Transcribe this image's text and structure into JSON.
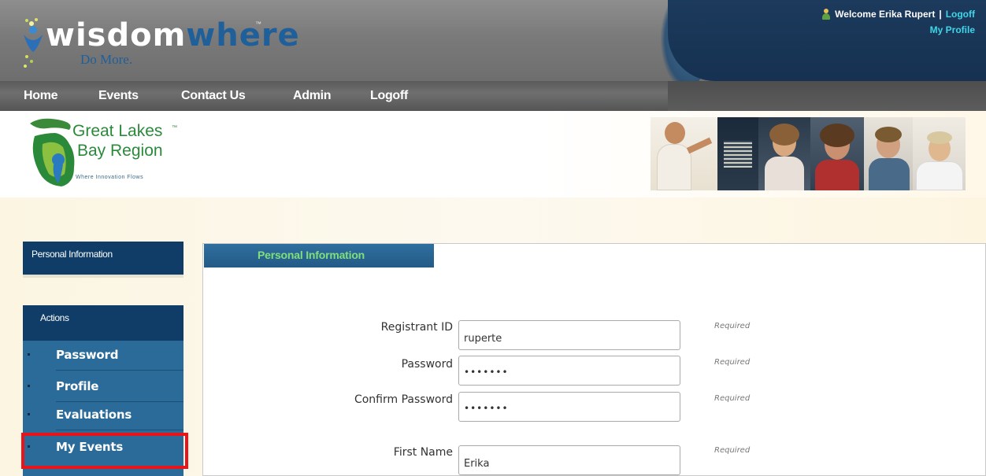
{
  "header": {
    "logo_part1": "wisdom",
    "logo_part2": "where",
    "logo_tm": "™",
    "logo_tagline": "Do More.",
    "welcome_text": "Welcome Erika Rupert",
    "separator": "|",
    "logoff_link": "Logoff",
    "my_profile_link": "My Profile"
  },
  "nav": {
    "items": [
      "Home",
      "Events",
      "Contact Us",
      "Admin",
      "Logoff"
    ]
  },
  "banner": {
    "brand_line1": "Great Lakes",
    "brand_tm": "™",
    "brand_line2": "Bay Region",
    "brand_tagline": "Where Innovation Flows"
  },
  "sidebar": {
    "info_title": "Personal Information",
    "actions_title": "Actions",
    "actions": [
      "Password",
      "Profile",
      "Evaluations",
      "My Events"
    ]
  },
  "panel": {
    "tab_label": "Personal Information",
    "required_text": "Required",
    "fields": [
      {
        "label": "Registrant ID",
        "value": "ruperte"
      },
      {
        "label": "Password",
        "value": "•••••••"
      },
      {
        "label": "Confirm Password",
        "value": "•••••••"
      },
      {
        "label": "First Name",
        "value": "Erika"
      }
    ]
  },
  "colors": {
    "header_dark": "#163151",
    "sidebar_dark": "#0f3d67",
    "sidebar_list": "#2a6b9a",
    "tab_text": "#7fe07a",
    "highlight": "#e8141a",
    "link": "#3fd6e8"
  }
}
